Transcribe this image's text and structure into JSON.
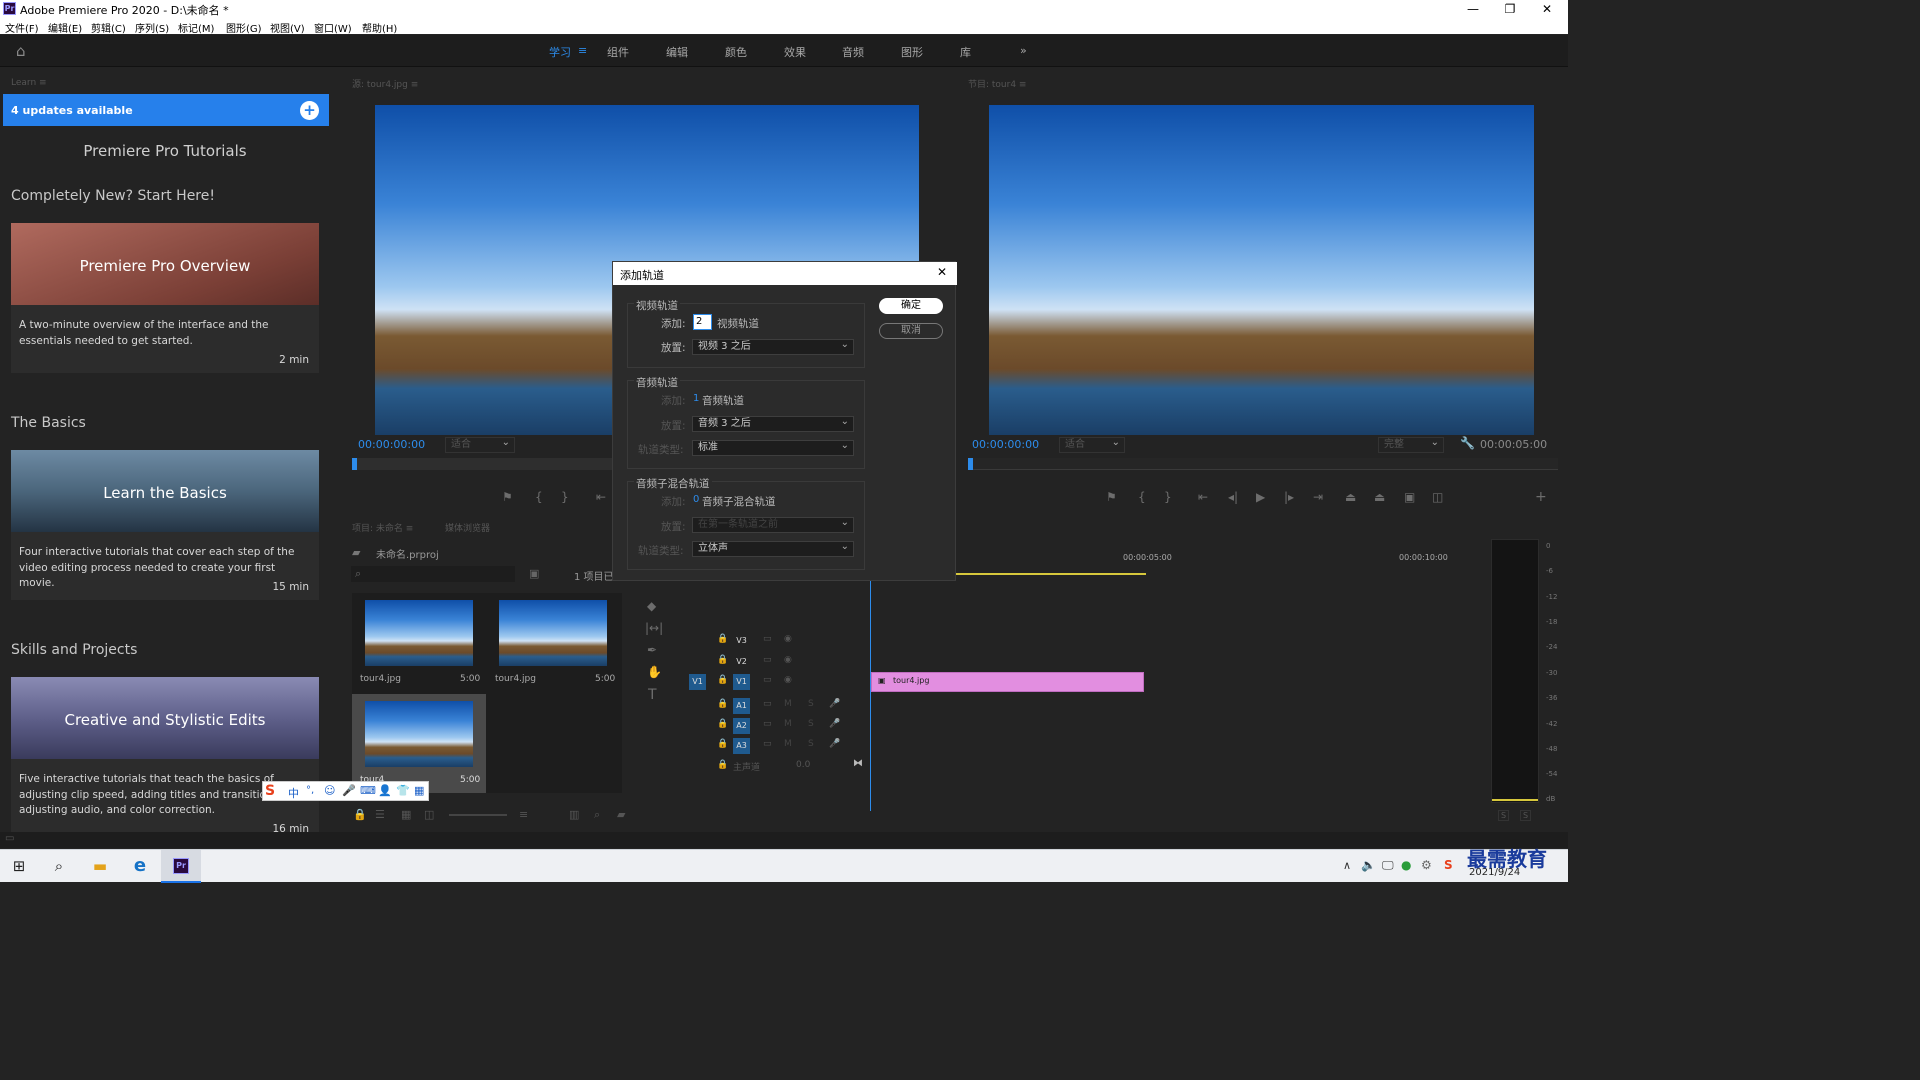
{
  "window": {
    "title": "Adobe Premiere Pro 2020 - D:\\未命名 *",
    "minimize": "—",
    "maximize": "❐",
    "close": "✕"
  },
  "menu": [
    "文件(F)",
    "编辑(E)",
    "剪辑(C)",
    "序列(S)",
    "标记(M)",
    "图形(G)",
    "视图(V)",
    "窗口(W)",
    "帮助(H)"
  ],
  "workspaces": {
    "items": [
      "学习",
      "组件",
      "编辑",
      "颜色",
      "效果",
      "音频",
      "图形",
      "库"
    ],
    "active": "学习",
    "more": "»"
  },
  "learn": {
    "tab": "Learn",
    "updates": "4 updates available",
    "title": "Premiere Pro Tutorials",
    "sections": [
      "Completely New? Start Here!",
      "The Basics",
      "Skills and Projects"
    ],
    "cards": [
      {
        "title": "Premiere Pro Overview",
        "desc": "A two-minute overview of the interface and the essentials needed to get started.",
        "duration": "2 min",
        "color": "#8a4a42"
      },
      {
        "title": "Learn the Basics",
        "desc": "Four interactive tutorials that cover each step of the video editing process needed to create your first movie.",
        "duration": "15 min",
        "color": "#3d5a72"
      },
      {
        "title": "Creative and Stylistic Edits",
        "desc": "Five interactive tutorials that teach the basics of adjusting clip speed, adding titles and transitions, adjusting audio, and color correction.",
        "duration": "16 min",
        "color": "#55567a"
      }
    ]
  },
  "source_monitor": {
    "tab": "源: tour4.jpg",
    "timecode": "00:00:00:00",
    "fit": "适合"
  },
  "program_monitor": {
    "tab": "节目: tour4",
    "timecode": "00:00:00:00",
    "fit": "适合",
    "quality": "完整",
    "duration": "00:00:05:00"
  },
  "dialog": {
    "title": "添加轨道",
    "ok": "确定",
    "cancel": "取消",
    "video": {
      "header": "视频轨道",
      "add_label": "添加:",
      "add_value": "2",
      "add_suffix": "视频轨道",
      "place_label": "放置:",
      "place_value": "视频 3 之后"
    },
    "audio": {
      "header": "音频轨道",
      "add_label": "添加:",
      "add_value": "1",
      "add_suffix": "音频轨道",
      "place_label": "放置:",
      "place_value": "音频 3 之后",
      "type_label": "轨道类型:",
      "type_value": "标准"
    },
    "submix": {
      "header": "音频子混合轨道",
      "add_label": "添加:",
      "add_value": "0",
      "add_suffix": "音频子混合轨道",
      "place_label": "放置:",
      "place_value": "在第一条轨道之前",
      "type_label": "轨道类型:",
      "type_value": "立体声"
    }
  },
  "project": {
    "tabs": [
      "项目: 未命名",
      "媒体浏览器"
    ],
    "file": "未命名.prproj",
    "count": "1 项目已选",
    "items": [
      {
        "name": "tour4.jpg",
        "duration": "5:00"
      },
      {
        "name": "tour4.jpg",
        "duration": "5:00"
      },
      {
        "name": "tour4",
        "duration": "5:00"
      }
    ]
  },
  "timeline": {
    "ruler": [
      "00:00:05:00",
      "00:00:10:00"
    ],
    "tracks": [
      "V3",
      "V2",
      "V1",
      "A1",
      "A2",
      "A3"
    ],
    "source_patch_v": "V1",
    "master": "主声道",
    "master_value": "0.0",
    "clip": "tour4.jpg",
    "clip_color": "#e28ee0"
  },
  "meter": {
    "labels": [
      "0",
      "-6",
      "-12",
      "-18",
      "-24",
      "-30",
      "-36",
      "-42",
      "-48",
      "-54",
      "dB"
    ]
  },
  "ime": {
    "items": [
      "中",
      "°,",
      "☺",
      "🎤",
      "⌨",
      "👤",
      "👕",
      "▦"
    ]
  },
  "taskbar": {
    "date": "2021/9/24",
    "watermark": "最需教育"
  }
}
